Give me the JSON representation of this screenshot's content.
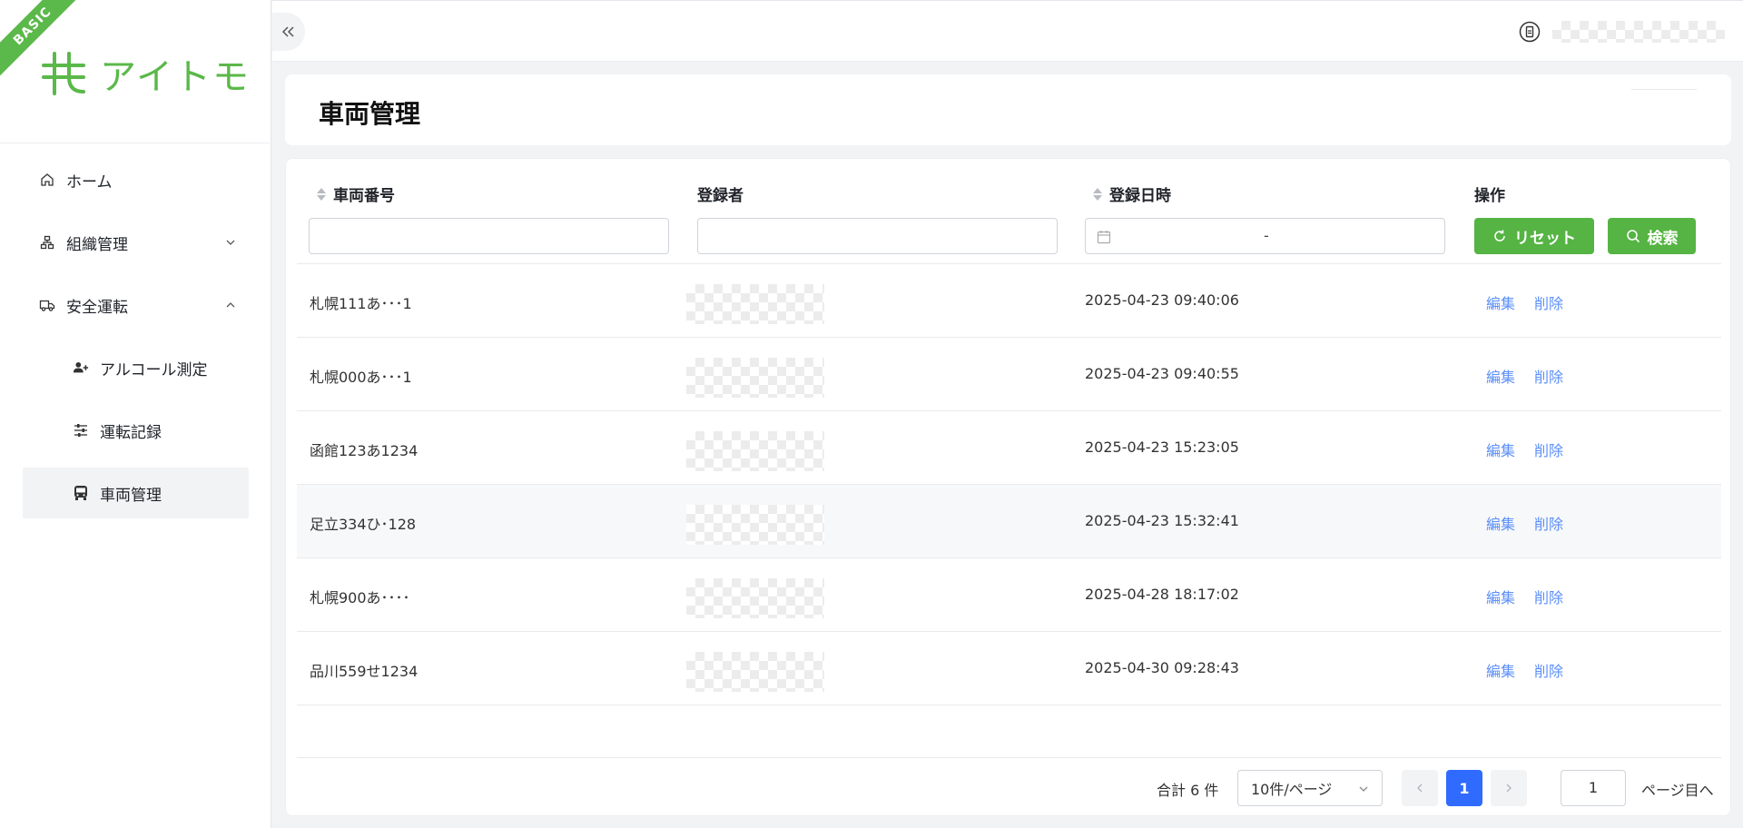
{
  "sidebar": {
    "badge": "BASIC",
    "logo_text": "アイトモ",
    "items": [
      {
        "label": "ホーム"
      },
      {
        "label": "組織管理"
      },
      {
        "label": "安全運転"
      },
      {
        "label": "アルコール測定"
      },
      {
        "label": "運転記録"
      },
      {
        "label": "車両管理"
      }
    ]
  },
  "page": {
    "title": "車両管理"
  },
  "table": {
    "headers": {
      "vehicle_no": "車両番号",
      "registrant": "登録者",
      "registered_at": "登録日時",
      "actions": "操作"
    },
    "date_sep": "-",
    "reset_label": "リセット",
    "search_label": "検索",
    "rows": [
      {
        "vehicle": "札幌111あ･･･1",
        "datetime": "2025-04-23 09:40:06",
        "edit": "編集",
        "delete": "削除"
      },
      {
        "vehicle": "札幌000あ･･･1",
        "datetime": "2025-04-23 09:40:55",
        "edit": "編集",
        "delete": "削除"
      },
      {
        "vehicle": "函館123あ1234",
        "datetime": "2025-04-23 15:23:05",
        "edit": "編集",
        "delete": "削除"
      },
      {
        "vehicle": "足立334ひ･128",
        "datetime": "2025-04-23 15:32:41",
        "edit": "編集",
        "delete": "削除"
      },
      {
        "vehicle": "札幌900あ････",
        "datetime": "2025-04-28 18:17:02",
        "edit": "編集",
        "delete": "削除"
      },
      {
        "vehicle": "品川559せ1234",
        "datetime": "2025-04-30 09:28:43",
        "edit": "編集",
        "delete": "削除"
      }
    ]
  },
  "pagination": {
    "total": "合計 6 件",
    "page_size": "10件/ページ",
    "current": "1",
    "goto_value": "1",
    "goto_label": "ページ目へ"
  },
  "colors": {
    "brand": "#5bb84a",
    "primary_button": "#55b443",
    "link": "#5b8ff9",
    "current_page": "#2f6bff"
  }
}
